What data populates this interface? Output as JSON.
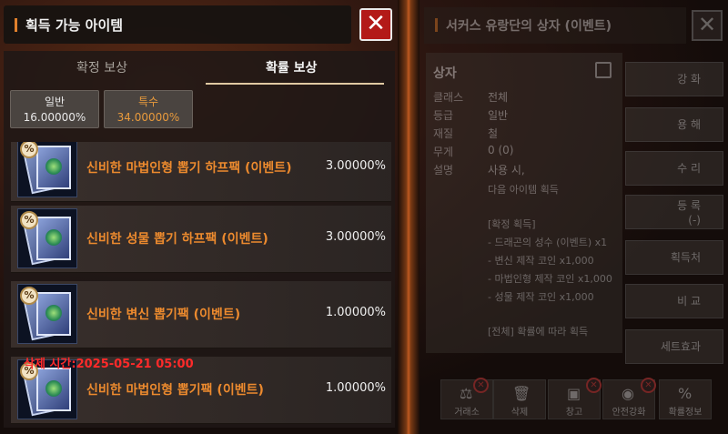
{
  "left": {
    "title": "획득 가능 아이템",
    "close_icon": "✕",
    "tabs": [
      "확정 보상",
      "확률 보상"
    ],
    "chips": [
      {
        "label": "일반",
        "value": "16.00000%"
      },
      {
        "label": "특수",
        "value": "34.00000%"
      }
    ],
    "items": [
      {
        "name": "신비한 마법인형 뽑기 하프팩 (이벤트)",
        "pct": "3.00000%"
      },
      {
        "name": "신비한 성물 뽑기 하프팩 (이벤트)",
        "pct": "3.00000%"
      },
      {
        "name": "신비한 변신 뽑기팩 (이벤트)",
        "pct": "1.00000%"
      },
      {
        "name": "신비한 마법인형 뽑기팩 (이벤트)",
        "pct": "1.00000%"
      }
    ],
    "badge": "%"
  },
  "right": {
    "title": "서커스 유랑단의 상자 (이벤트)",
    "close_icon": "✕",
    "heading": "상자",
    "props": [
      {
        "k": "클래스",
        "v": "전체"
      },
      {
        "k": "등급",
        "v": "일반"
      },
      {
        "k": "재질",
        "v": "철"
      },
      {
        "k": "무게",
        "v": "0 (0)"
      },
      {
        "k": "설명",
        "v": "사용 시,"
      }
    ],
    "desc_lines": [
      "다음 아이템 획득",
      "",
      "[확정 획득]",
      "- 드래곤의 성수 (이벤트) x1",
      "- 변신 제작 코인 x1,000",
      "- 마법인형 제작 코인 x1,000",
      "- 성물 제작 코인 x1,000",
      "",
      "[전체] 확률에 따라 획득"
    ],
    "delete_time": "삭제 시간:2025-05-21 05:00",
    "side_buttons": [
      "강 화",
      "용 해",
      "수 리",
      "등 록",
      "획득처",
      "비 교",
      "세트효과"
    ],
    "register_sub": "(-)",
    "bottom_buttons": [
      "거래소",
      "삭제",
      "창고",
      "안전강화",
      "확률정보"
    ]
  }
}
